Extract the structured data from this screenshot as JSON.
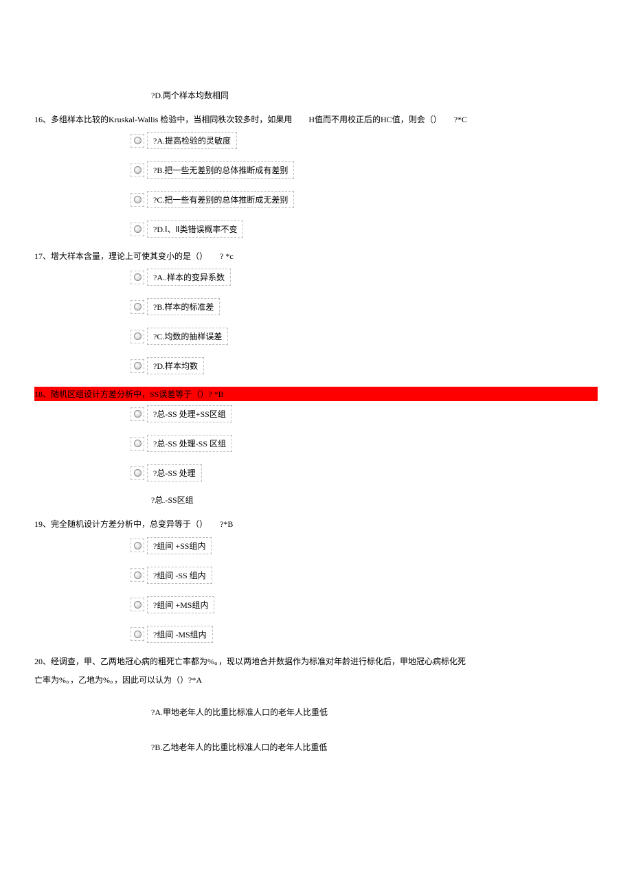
{
  "q15": {
    "optD": "?D.两个样本均数相同"
  },
  "q16": {
    "text": "16、多组样本比较的Kruskal-Wallis 检验中，当相同秩次较多时，如果用　　H值而不用校正后的HC值，则会（）　　?*C",
    "optA": "?A.提高检验的灵敏度",
    "optB": "?B.把一些无差别的总体推断成有差别",
    "optC": "?C.把一些有差别的总体推断成无差别",
    "optD": "?D.Ⅰ、Ⅱ类错误概率不变"
  },
  "q17": {
    "text": "17、增大样本含量，理论上可使其变小的是（）　　? *c",
    "optA": "?A..样本的变异系数",
    "optB": "?B.样本的标准差",
    "optC": "?C.均数的抽样误差",
    "optD": "?D.样本均数"
  },
  "q18": {
    "text": "18、随机区组设计方差分析中，SS误差等于（）? *B",
    "optA": "?总-SS 处理+SS区组",
    "optB": "?总-SS 处理-SS 区组",
    "optC": "?总-SS 处理",
    "optD": "?总.-SS区组"
  },
  "q19": {
    "text": "19、完全随机设计方差分析中，总变异等于（）　　?*B",
    "optA": "?组间 +SS组内",
    "optB": "?组间 -SS 组内",
    "optC": "?组间 +MS组内",
    "optD": "?组间 -MS组内"
  },
  "q20": {
    "text1": "20、经调查，甲、乙两地冠心病的粗死亡率都为%。，现以两地合并数据作为标准对年龄进行标化后，甲地冠心病标化死",
    "text2": "亡率为%。，乙地为%。，因此可以认为（）?*A",
    "optA": "?A.甲地老年人的比重比标准人口的老年人比重低",
    "optB": "?B.乙地老年人的比重比标准人口的老年人比重低"
  }
}
